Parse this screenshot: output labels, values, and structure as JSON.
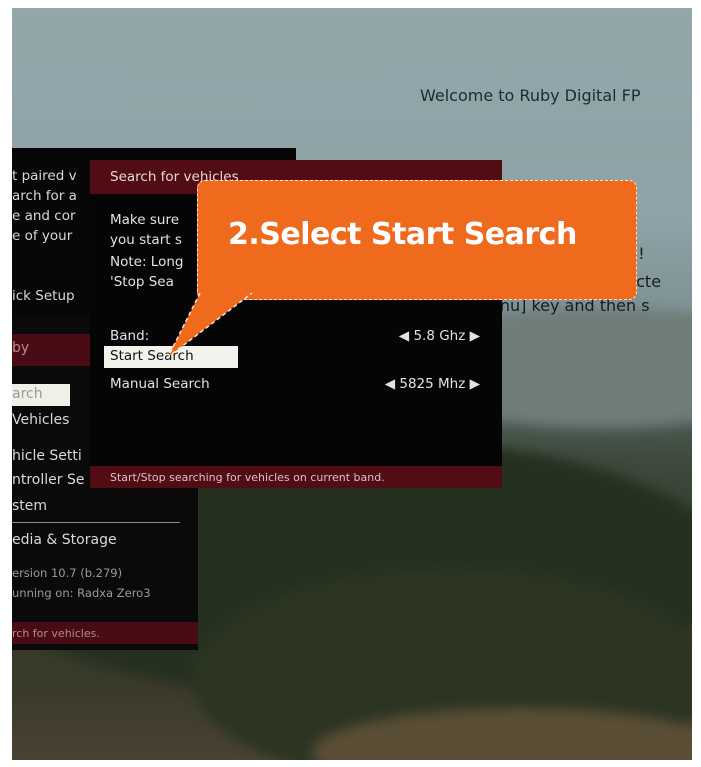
{
  "background": {
    "welcome": "Welcome to Ruby Digital FP",
    "line_red": "red!",
    "line_select": "electe",
    "line_menu": "enu] key and then s"
  },
  "paired_menu": {
    "lines": [
      "t paired v",
      "arch for a",
      "e and cor",
      "e of your"
    ],
    "quick_setup": "ick Setup"
  },
  "main_menu": {
    "header": "by",
    "selected": "arch",
    "items": [
      "Vehicles",
      "hicle Setti",
      "ntroller Se",
      "stem",
      "edia & Storage"
    ],
    "version": "ersion  10.7  (b.279)",
    "running": "unning  on:  Radxa  Zero3",
    "footer": "rch  for  vehicles."
  },
  "search_dialog": {
    "title": "Search for vehicles",
    "desc": [
      "Make sure",
      "you start s",
      "Note:  Long",
      "'Stop  Sea"
    ],
    "band_label": "Band:",
    "band_value": "◀ 5.8 Ghz ▶",
    "start_search": "Start Search",
    "manual_label": "Manual Search",
    "manual_value": "◀ 5825 Mhz ▶",
    "footer": "Start/Stop  searching  for  vehicles  on  current  band."
  },
  "callout": {
    "text": "2.Select Start Search",
    "color": "#f06a1e"
  }
}
